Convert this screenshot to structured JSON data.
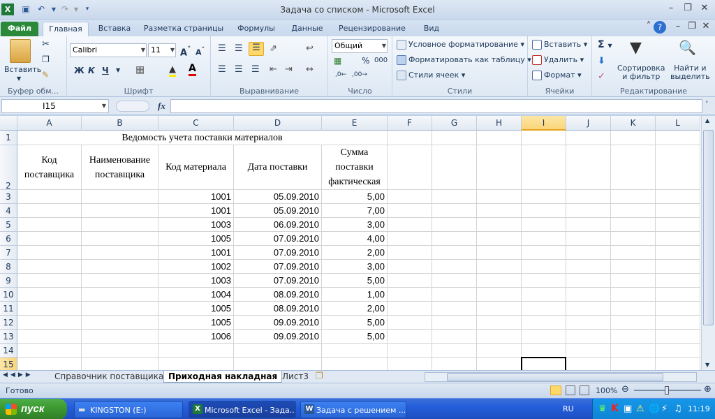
{
  "window": {
    "title": "Задача со списком  -  Microsoft Excel"
  },
  "tabs": [
    "Файл",
    "Главная",
    "Вставка",
    "Разметка страницы",
    "Формулы",
    "Данные",
    "Рецензирование",
    "Вид"
  ],
  "ribbon": {
    "clipboard": {
      "paste": "Вставить",
      "label": "Буфер обм..."
    },
    "font": {
      "name": "Calibri",
      "size": "11",
      "bold": "Ж",
      "italic": "К",
      "underline": "Ч",
      "label": "Шрифт"
    },
    "alignment": {
      "label": "Выравнивание"
    },
    "number": {
      "format": "Общий",
      "percent": "%",
      "thousands": "000",
      "label": "Число"
    },
    "styles": {
      "conditional": "Условное форматирование",
      "table": "Форматировать как таблицу",
      "cell_styles": "Стили ячеек",
      "label": "Стили"
    },
    "cells": {
      "insert": "Вставить",
      "delete": "Удалить",
      "format": "Формат",
      "label": "Ячейки"
    },
    "editing": {
      "sum": "Σ",
      "sort": "Сортировка\nи фильтр",
      "find": "Найти и\nвыделить",
      "label": "Редактирование"
    }
  },
  "formula_bar": {
    "name_box": "I15",
    "fx": "fx",
    "content": ""
  },
  "columns": [
    "A",
    "B",
    "C",
    "D",
    "E",
    "F",
    "G",
    "H",
    "I",
    "J",
    "K",
    "L"
  ],
  "sheet": {
    "title": "Ведомость учета поставки материалов",
    "headers": [
      "Код поставщика",
      "Наименование поставщика",
      "Код материала",
      "Дата поставки",
      "Сумма поставки фактическая"
    ],
    "rows": [
      [
        "",
        "",
        "1001",
        "05.09.2010",
        "5,00"
      ],
      [
        "",
        "",
        "1001",
        "05.09.2010",
        "7,00"
      ],
      [
        "",
        "",
        "1003",
        "06.09.2010",
        "3,00"
      ],
      [
        "",
        "",
        "1005",
        "07.09.2010",
        "4,00"
      ],
      [
        "",
        "",
        "1001",
        "07.09.2010",
        "2,00"
      ],
      [
        "",
        "",
        "1002",
        "07.09.2010",
        "3,00"
      ],
      [
        "",
        "",
        "1003",
        "07.09.2010",
        "5,00"
      ],
      [
        "",
        "",
        "1004",
        "08.09.2010",
        "1,00"
      ],
      [
        "",
        "",
        "1005",
        "08.09.2010",
        "2,00"
      ],
      [
        "",
        "",
        "1005",
        "09.09.2010",
        "5,00"
      ],
      [
        "",
        "",
        "1006",
        "09.09.2010",
        "5,00"
      ]
    ]
  },
  "row_numbers": [
    "1",
    "2",
    "3",
    "4",
    "5",
    "6",
    "7",
    "8",
    "9",
    "10",
    "11",
    "12",
    "13",
    "14",
    "15"
  ],
  "sheet_tabs": [
    "Справочник поставщика",
    "Приходная накладная",
    "Лист3"
  ],
  "status": {
    "ready": "Готово",
    "zoom": "100%"
  },
  "taskbar": {
    "start": "пуск",
    "tasks": [
      "KINGSTON (E:)",
      "Microsoft Excel - Зада...",
      "Задача с решением ..."
    ],
    "lang": "RU",
    "clock": "11:19"
  }
}
